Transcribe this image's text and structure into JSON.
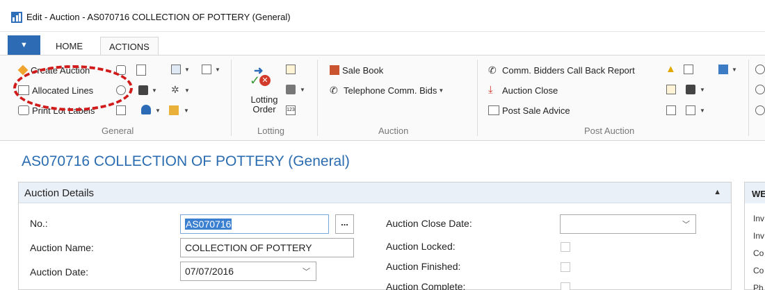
{
  "window": {
    "title": "Edit - Auction - AS070716 COLLECTION OF POTTERY (General)"
  },
  "tabs": {
    "menu_glyph": "▼",
    "home": "HOME",
    "actions": "ACTIONS"
  },
  "ribbon": {
    "general": {
      "label": "General",
      "create_auction": "Create Auction",
      "allocated_lines": "Allocated Lines",
      "print_lot_labels": "Print Lot Labels"
    },
    "lotting": {
      "label": "Lotting",
      "lotting_order": "Lotting Order"
    },
    "auction": {
      "label": "Auction",
      "sale_book": "Sale Book",
      "telephone_comm_bids": "Telephone Comm. Bids"
    },
    "post_auction": {
      "label": "Post Auction",
      "comm_bidders_call_back_report": "Comm. Bidders Call Back Report",
      "auction_close": "Auction Close",
      "post_sale_advice": "Post Sale Advice"
    }
  },
  "page": {
    "title": "AS070716 COLLECTION OF POTTERY (General)"
  },
  "auction_details": {
    "title": "Auction Details",
    "no_label": "No.:",
    "no_value": "AS070716",
    "name_label": "Auction Name:",
    "name_value": "COLLECTION OF POTTERY",
    "date_label": "Auction Date:",
    "date_value": "07/07/2016",
    "close_date_label": "Auction Close Date:",
    "close_date_value": "",
    "locked_label": "Auction Locked:",
    "finished_label": "Auction Finished:",
    "complete_label": "Auction Complete:",
    "locked": false,
    "finished": false,
    "complete": false
  },
  "factbox": {
    "title": "WE",
    "lines": [
      "Inv",
      "Inv",
      "Co",
      "Co",
      "Ph"
    ]
  },
  "colors": {
    "accent_blue": "#2b6cb0",
    "menu_tab_blue": "#2d6cb5",
    "highlight_red": "#d11a1a",
    "selection_blue": "#3b7fd0"
  }
}
